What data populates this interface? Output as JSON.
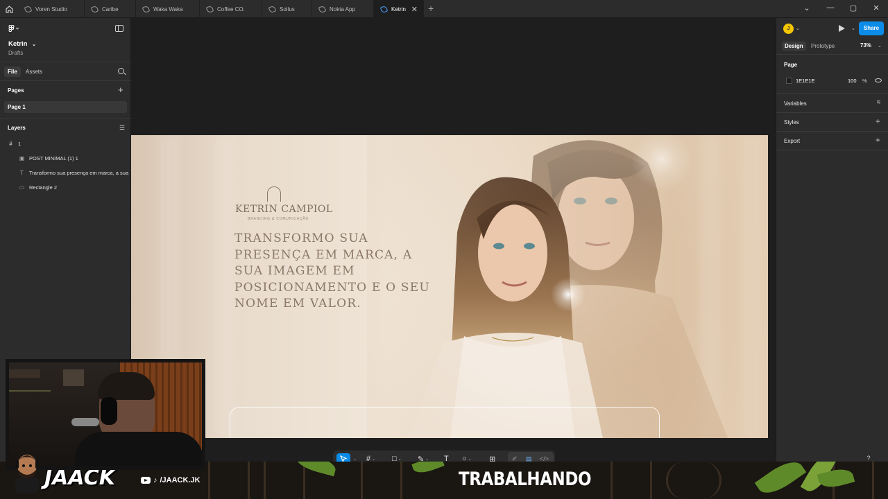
{
  "tabs": [
    {
      "label": "Voren Studio"
    },
    {
      "label": "Caribe"
    },
    {
      "label": "Waka Waka"
    },
    {
      "label": "Coffee CO."
    },
    {
      "label": "Sollus"
    },
    {
      "label": "Nokta App"
    },
    {
      "label": "Ketrin",
      "active": true
    }
  ],
  "left_panel": {
    "file_name": "Ketrin",
    "location": "Drafts",
    "tabs": [
      "File",
      "Assets"
    ],
    "pages_heading": "Pages",
    "pages": [
      "Page 1"
    ],
    "layers_heading": "Layers",
    "layers": [
      {
        "label": "1",
        "icon": "frame-icon"
      },
      {
        "label": "POST MINIMAL (1) 1",
        "icon": "image-icon"
      },
      {
        "label": "Transformo sua presença em marca, a sua",
        "icon": "text-icon"
      },
      {
        "label": "Rectangle 2",
        "icon": "rectangle-icon"
      }
    ]
  },
  "right_panel": {
    "avatar_initial": "J",
    "share_label": "Share",
    "tabs": [
      "Design",
      "Prototype"
    ],
    "zoom": "73%",
    "page_heading": "Page",
    "page_color": "1E1E1E",
    "page_opacity": "100",
    "percent": "%",
    "sections": [
      "Variables",
      "Styles",
      "Export"
    ]
  },
  "canvas": {
    "background_color": "#1E1E1E",
    "design": {
      "logo": "KETRIN CAMPIOL",
      "logo_sub": "BRANDING & COMUNICAÇÃO",
      "headline": "Transformo sua presença em marca, a sua imagem em posicionamento e o seu nome em valor."
    }
  },
  "stream": {
    "brand": "JAACK",
    "social": "/JAACK.JK",
    "status": "TRABALHANDO"
  },
  "help_label": "?",
  "colors": {
    "accent": "#0C8CE9",
    "panel": "#2C2C2C",
    "avatar": "#F2C500"
  }
}
